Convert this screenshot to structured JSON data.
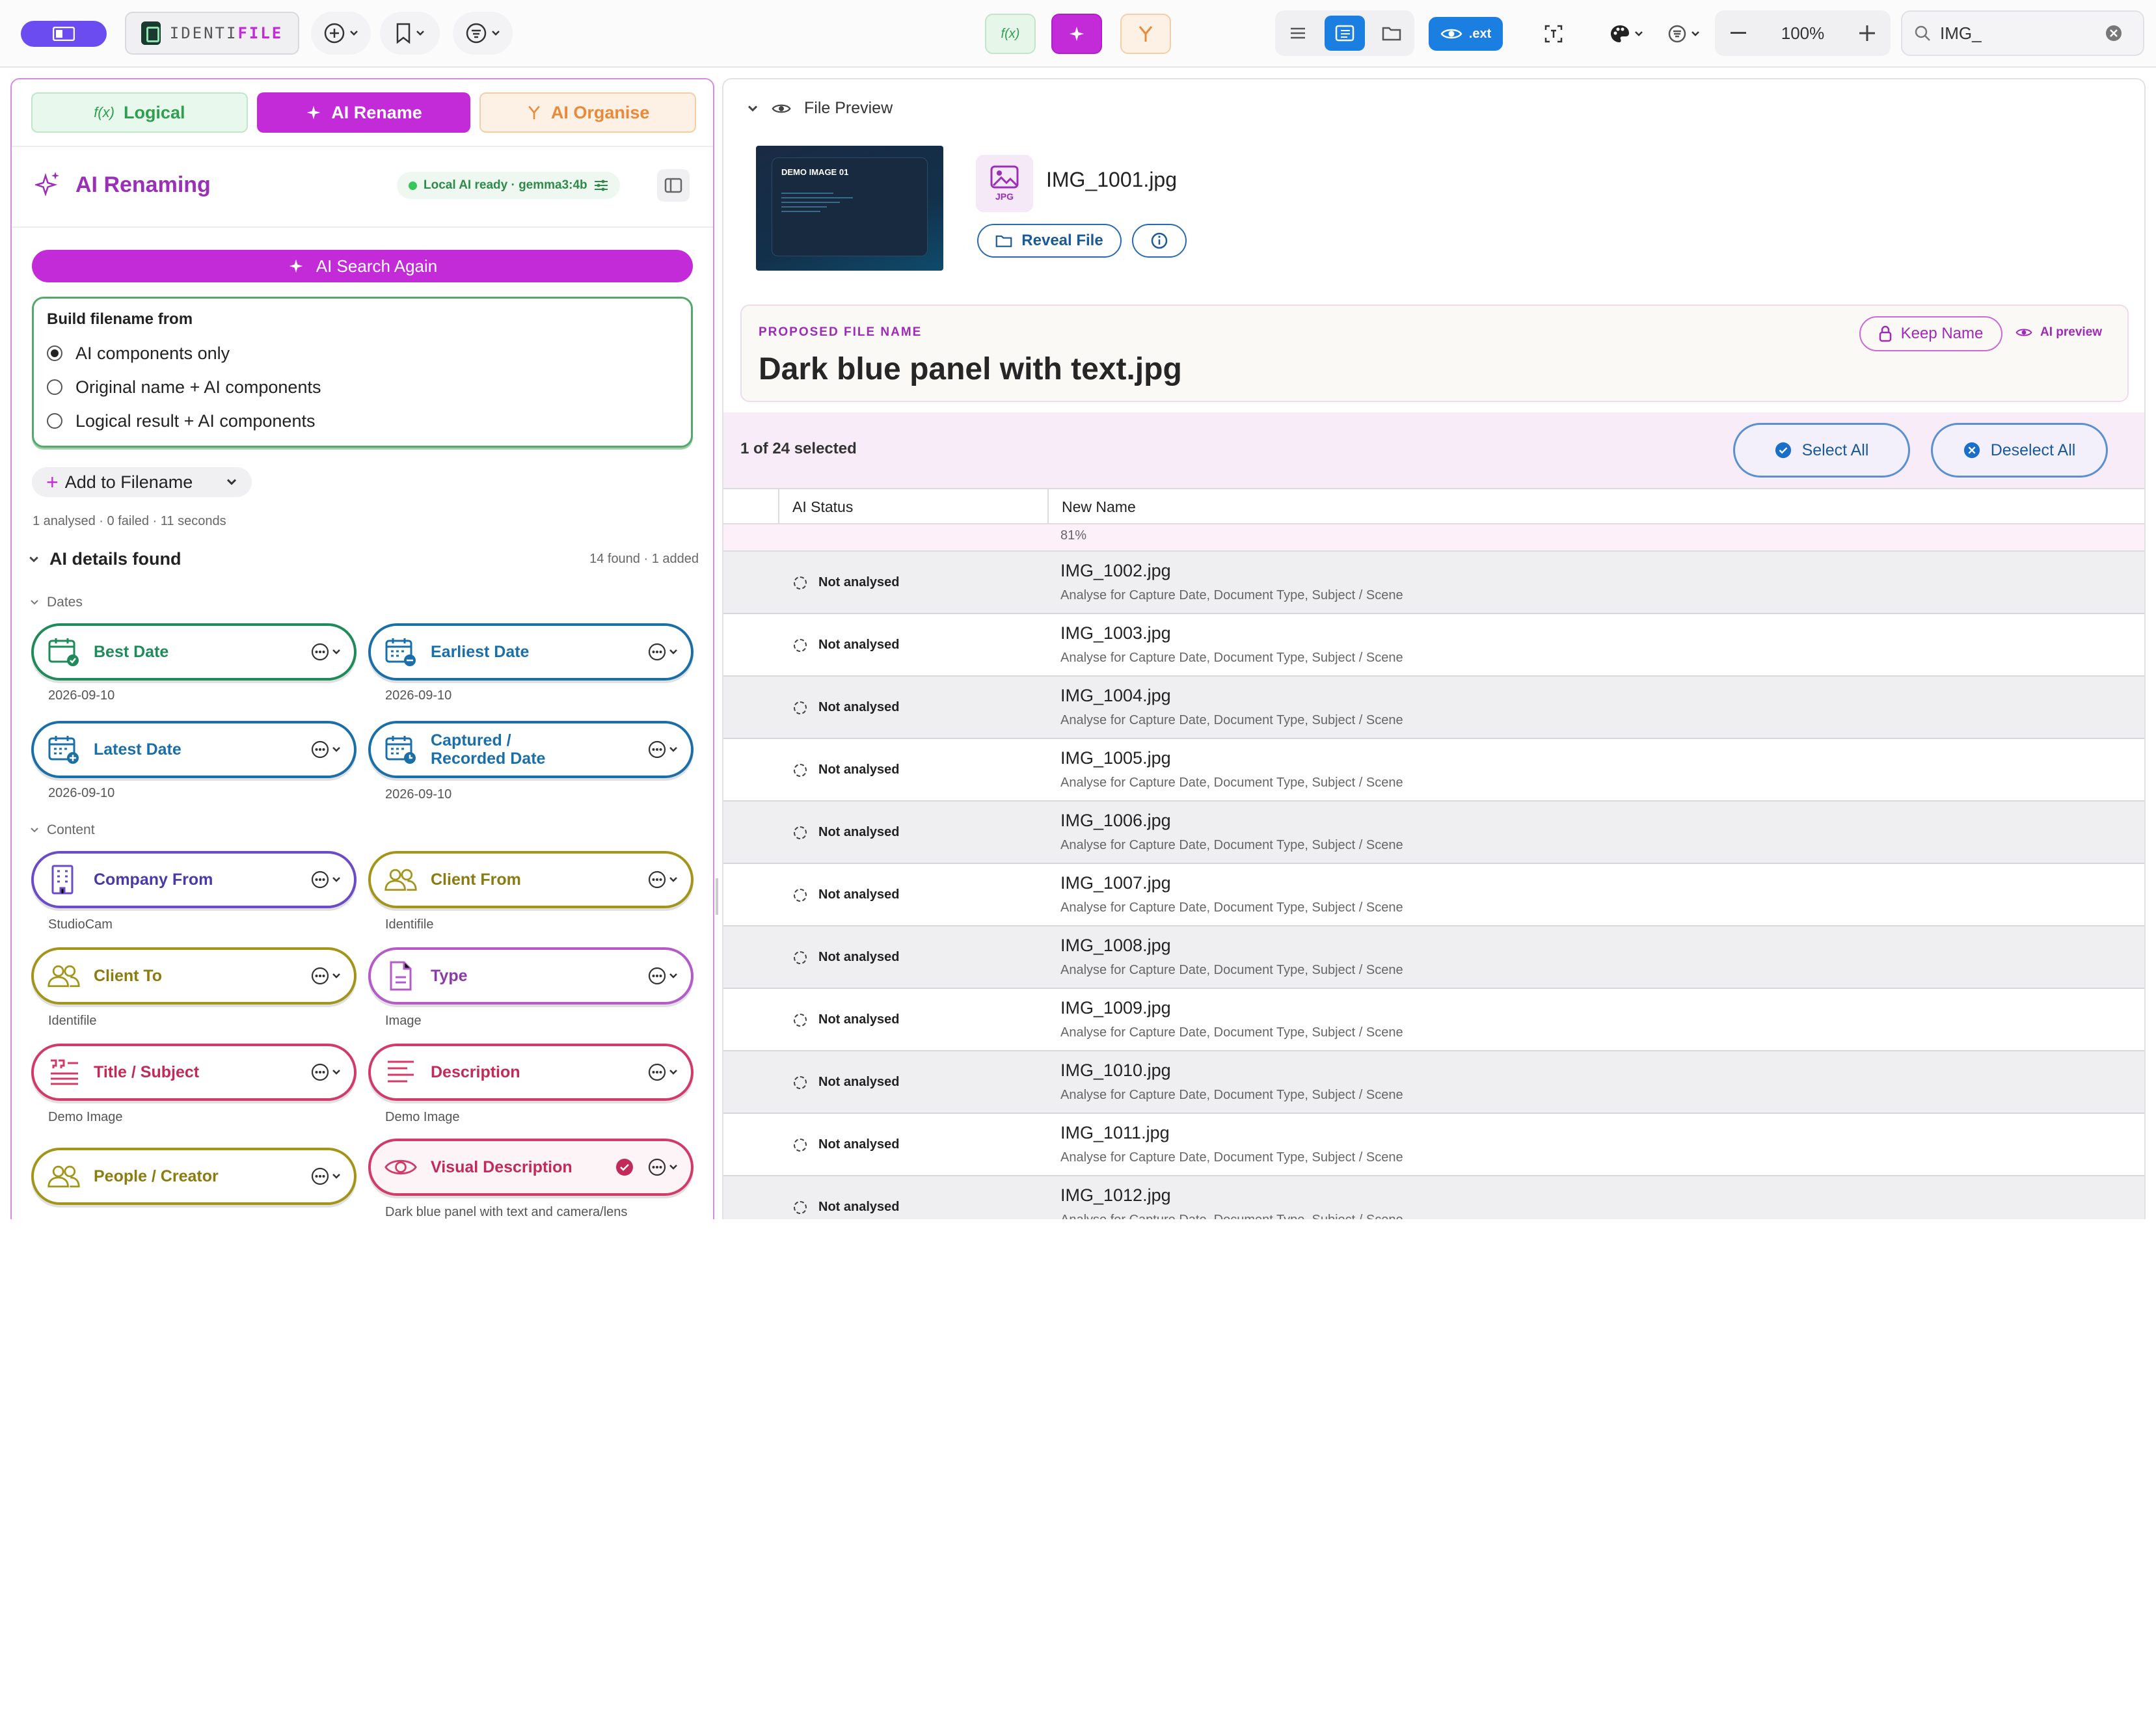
{
  "toolbar": {
    "brand_prefix": "IDENTI",
    "brand_suffix": "FILE",
    "logical_icon_text": "f(x)",
    "ext_label": ".ext",
    "zoom": "100%",
    "search_value": "IMG_",
    "colors": {
      "accent": "#c32bd9",
      "blue": "#1a7fe0",
      "purple": "#6a4cf0"
    }
  },
  "left": {
    "tabs": [
      "Logical",
      "AI Rename",
      "AI Organise"
    ],
    "tab_logical_icon": "f(x)",
    "title": "AI Renaming",
    "ai_status": "Local AI ready · gemma3:4b",
    "search_again": "AI Search Again",
    "build_label": "Build filename from",
    "options": [
      "AI components only",
      "Original name + AI components",
      "Logical result + AI components"
    ],
    "selected_option": 0,
    "add_to_filename": "Add to Filename",
    "analysed": "1 analysed · 0 failed · 11 seconds",
    "details_title": "AI details found",
    "details_count": "14 found · 1 added",
    "section_dates": "Dates",
    "section_content": "Content",
    "chips": [
      {
        "label": "Best Date",
        "value": "2026-09-10",
        "icon": "calendar-check-icon"
      },
      {
        "label": "Earliest Date",
        "value": "2026-09-10",
        "icon": "calendar-minus-icon"
      },
      {
        "label": "Latest Date",
        "value": "2026-09-10",
        "icon": "calendar-plus-icon"
      },
      {
        "label": "Captured / Recorded Date",
        "label_line1": "Captured /",
        "label_line2": "Recorded Date",
        "value": "2026-09-10",
        "icon": "calendar-clock-icon"
      },
      {
        "label": "Company From",
        "value": "StudioCam",
        "icon": "building-icon"
      },
      {
        "label": "Client From",
        "value": "Identifile",
        "icon": "people-icon"
      },
      {
        "label": "Client To",
        "value": "Identifile",
        "icon": "people-icon"
      },
      {
        "label": "Type",
        "value": "Image",
        "icon": "document-icon"
      },
      {
        "label": "Title / Subject",
        "value": "Demo Image",
        "icon": "quote-icon"
      },
      {
        "label": "Description",
        "value": "Demo Image",
        "icon": "text-lines-icon"
      },
      {
        "label": "People / Creator",
        "value": "",
        "icon": "people-icon"
      },
      {
        "label": "Visual Description",
        "value": "Dark blue panel with text and camera/lens",
        "icon": "eye-icon"
      }
    ]
  },
  "right": {
    "preview_title": "File Preview",
    "thumb_title": "DEMO IMAGE 01",
    "file_ext": "JPG",
    "file_name": "IMG_1001.jpg",
    "reveal": "Reveal File",
    "proposed_label": "PROPOSED FILE NAME",
    "proposed_name": "Dark blue panel with text.jpg",
    "keep_name": "Keep Name",
    "ai_preview": "AI preview",
    "selected": "1 of 24 selected",
    "select_all": "Select All",
    "deselect_all": "Deselect All",
    "col_status": "AI Status",
    "col_new_name": "New Name",
    "partial_pct": "81%",
    "rows": [
      {
        "status": "Not analysed",
        "name": "IMG_1002.jpg",
        "sub": "Analyse for Capture Date, Document Type, Subject / Scene"
      },
      {
        "status": "Not analysed",
        "name": "IMG_1003.jpg",
        "sub": "Analyse for Capture Date, Document Type, Subject / Scene"
      },
      {
        "status": "Not analysed",
        "name": "IMG_1004.jpg",
        "sub": "Analyse for Capture Date, Document Type, Subject / Scene"
      },
      {
        "status": "Not analysed",
        "name": "IMG_1005.jpg",
        "sub": "Analyse for Capture Date, Document Type, Subject / Scene"
      },
      {
        "status": "Not analysed",
        "name": "IMG_1006.jpg",
        "sub": "Analyse for Capture Date, Document Type, Subject / Scene"
      },
      {
        "status": "Not analysed",
        "name": "IMG_1007.jpg",
        "sub": "Analyse for Capture Date, Document Type, Subject / Scene"
      },
      {
        "status": "Not analysed",
        "name": "IMG_1008.jpg",
        "sub": "Analyse for Capture Date, Document Type, Subject / Scene"
      },
      {
        "status": "Not analysed",
        "name": "IMG_1009.jpg",
        "sub": "Analyse for Capture Date, Document Type, Subject / Scene"
      },
      {
        "status": "Not analysed",
        "name": "IMG_1010.jpg",
        "sub": "Analyse for Capture Date, Document Type, Subject / Scene"
      },
      {
        "status": "Not analysed",
        "name": "IMG_1011.jpg",
        "sub": "Analyse for Capture Date, Document Type, Subject / Scene"
      },
      {
        "status": "Not analysed",
        "name": "IMG_1012.jpg",
        "sub": "Analyse for Capture Date, Document Type, Subject / Scene"
      }
    ]
  }
}
